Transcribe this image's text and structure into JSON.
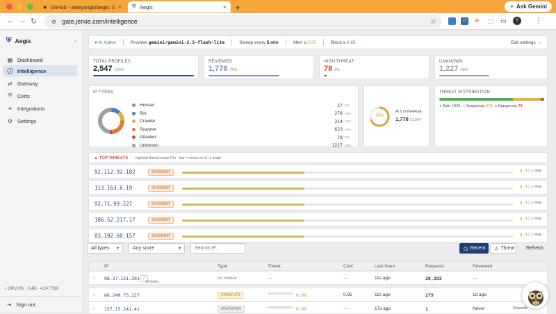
{
  "browser": {
    "tab1_title": "GitHub - axieyangb/aegis: Se…",
    "tab2_title": "Aegis",
    "url": "gate.jerxie.com/intelligence",
    "ask_gemini": "Ask Gemini",
    "profile_initial": "Y",
    "ext_badge": "17"
  },
  "sidebar": {
    "brand": "Aegis",
    "items": [
      {
        "label": "Dashboard",
        "icon": "dashboard-icon"
      },
      {
        "label": "Intelligence",
        "icon": "info-icon"
      },
      {
        "label": "Gateway",
        "icon": "gateway-icon"
      },
      {
        "label": "Certs",
        "icon": "shield-icon"
      },
      {
        "label": "Integrations",
        "icon": "integrations-icon"
      },
      {
        "label": "Settings",
        "icon": "gear-icon"
      }
    ],
    "cpu": "CPU 2% · 2.4G · 4.1K TOK",
    "sign_out": "Sign out"
  },
  "status": {
    "ai_active": "AI Active",
    "provider_label": "Provider",
    "provider": "gemini/gemini-2.5-flash-lite",
    "sweep_label": "Sweep every",
    "sweep": "5 min",
    "alert_label": "Alert ≥",
    "alert": "0.35",
    "block_label": "Block ≥",
    "block": "0.65",
    "edit": "Edit settings →"
  },
  "kpis": [
    {
      "label": "TOTAL PROFILES",
      "value": "2,547",
      "pct": "100%",
      "fraction": 1.0,
      "color": "#2f4f8f"
    },
    {
      "label": "REVIEWED",
      "value": "1,778",
      "pct": "70%",
      "fraction": 0.7,
      "color": "#7f8fc8"
    },
    {
      "label": "HIGH THREAT",
      "value": "78",
      "pct": "3%",
      "fraction": 0.03,
      "color": "#d24a3c"
    },
    {
      "label": "UNKNOWN",
      "value": "1,227",
      "pct": "48%",
      "fraction": 0.48,
      "color": "#9aa0a8"
    }
  ],
  "ip_types": {
    "title": "IP TYPES",
    "rows": [
      {
        "label": "Human",
        "count": "27",
        "pct": "1%",
        "color": "#5aa95a"
      },
      {
        "label": "Bot",
        "count": "278",
        "pct": "11%",
        "color": "#4a7fc1"
      },
      {
        "label": "Crawler",
        "count": "314",
        "pct": "12%",
        "color": "#d9b33a"
      },
      {
        "label": "Scanner",
        "count": "623",
        "pct": "24%",
        "color": "#e07b39"
      },
      {
        "label": "Attacker",
        "count": "78",
        "pct": "3%",
        "color": "#d24a3c"
      },
      {
        "label": "Unknown",
        "count": "1227",
        "pct": "48%",
        "color": "#9aa0a8"
      }
    ]
  },
  "coverage": {
    "pct": "70%",
    "label": "AI COVERAGE",
    "value": "1,778",
    "total": "/ 2,547",
    "fraction": 0.7
  },
  "distribution": {
    "title": "THREAT DISTRIBUTION",
    "safe_label": "Safe",
    "safe": "1801",
    "suspicious_label": "Suspicious",
    "suspicious": "678",
    "dangerous_label": "Dangerous",
    "dangerous": "78",
    "safe_n": 1801,
    "suspicious_n": 678,
    "dangerous_n": 78
  },
  "top_threats": {
    "title": "▲ TOP THREATS",
    "subtitle": "highest threat-score IPs · bar = score on 0–1 scale",
    "rows": [
      {
        "ip": "92.112.92.182",
        "type": "SCANNER",
        "score": 0.37,
        "score_text": "0.37",
        "reqs": "1 reqs"
      },
      {
        "ip": "113.163.6.19",
        "type": "SCANNER",
        "score": 0.37,
        "score_text": "0.37",
        "reqs": "1 reqs"
      },
      {
        "ip": "92.71.99.227",
        "type": "SCANNER",
        "score": 0.37,
        "score_text": "0.37",
        "reqs": "1 reqs"
      },
      {
        "ip": "186.52.217.17",
        "type": "SCANNER",
        "score": 0.37,
        "score_text": "0.37",
        "reqs": "1 reqs"
      },
      {
        "ip": "83.192.60.157",
        "type": "SCANNER",
        "score": 0.37,
        "score_text": "0.37",
        "reqs": "1 reqs"
      }
    ]
  },
  "filters": {
    "types": "All types",
    "score": "Any score",
    "search_placeholder": "Search IP...",
    "recent": "Recent",
    "threat": "Threat",
    "refresh": "Refresh"
  },
  "table": {
    "headers": [
      "IP",
      "Type",
      "Threat",
      "Conf",
      "Last Seen",
      "Requests",
      "Reviewed"
    ],
    "rows": [
      {
        "ip": "98.37.151.201",
        "tag": "Whitelist",
        "type": "no review",
        "threat": "—",
        "conf": "—",
        "last": "11s ago",
        "req": "28,293",
        "rev": "—"
      },
      {
        "ip": "66.249.73.227",
        "tag": "",
        "type": "CRAWLER",
        "threat": "0.00",
        "conf": "0.95",
        "last": "11s ago",
        "req": "279",
        "rev": "1d ago"
      },
      {
        "ip": "157.15.141.41",
        "tag": "",
        "type": "UNKNOWN",
        "threat": "0.00",
        "conf": "—",
        "last": "17s ago",
        "req": "1",
        "rev": "Never"
      }
    ],
    "override": "Override"
  }
}
